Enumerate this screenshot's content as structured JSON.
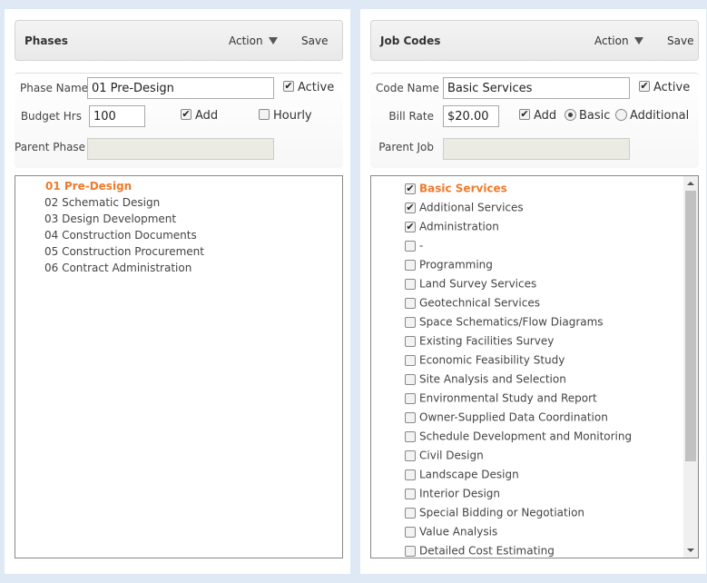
{
  "phases": {
    "header": {
      "title": "Phases",
      "action_label": "Action",
      "save_label": "Save"
    },
    "form": {
      "phase_name_label": "Phase Name",
      "phase_name_value": "01 Pre-Design",
      "active_label": "Active",
      "active_checked": true,
      "budget_hrs_label": "Budget Hrs",
      "budget_hrs_value": "100",
      "add_label": "Add",
      "add_checked": true,
      "hourly_label": "Hourly",
      "hourly_checked": false,
      "parent_phase_label": "Parent Phase",
      "parent_phase_value": ""
    },
    "items": [
      {
        "label": "01 Pre-Design",
        "selected": true
      },
      {
        "label": "02 Schematic Design",
        "selected": false
      },
      {
        "label": "03 Design Development",
        "selected": false
      },
      {
        "label": "04 Construction Documents",
        "selected": false
      },
      {
        "label": "05 Construction Procurement",
        "selected": false
      },
      {
        "label": "06 Contract Administration",
        "selected": false
      }
    ]
  },
  "job_codes": {
    "header": {
      "title": "Job Codes",
      "action_label": "Action",
      "save_label": "Save"
    },
    "form": {
      "code_name_label": "Code Name",
      "code_name_value": "Basic Services",
      "active_label": "Active",
      "active_checked": true,
      "bill_rate_label": "Bill Rate",
      "bill_rate_value": "$20.00",
      "add_label": "Add",
      "add_checked": true,
      "basic_label": "Basic",
      "additional_label": "Additional",
      "rate_type_selected": "Basic",
      "parent_job_label": "Parent Job",
      "parent_job_value": ""
    },
    "items": [
      {
        "label": "Basic Services",
        "checked": true,
        "selected": true
      },
      {
        "label": "Additional Services",
        "checked": true,
        "selected": false
      },
      {
        "label": "Administration",
        "checked": true,
        "selected": false
      },
      {
        "label": "-",
        "checked": false,
        "selected": false
      },
      {
        "label": "Programming",
        "checked": false,
        "selected": false
      },
      {
        "label": "Land Survey Services",
        "checked": false,
        "selected": false
      },
      {
        "label": "Geotechnical Services",
        "checked": false,
        "selected": false
      },
      {
        "label": "Space Schematics/Flow Diagrams",
        "checked": false,
        "selected": false
      },
      {
        "label": "Existing Facilities Survey",
        "checked": false,
        "selected": false
      },
      {
        "label": "Economic Feasibility Study",
        "checked": false,
        "selected": false
      },
      {
        "label": "Site Analysis and Selection",
        "checked": false,
        "selected": false
      },
      {
        "label": "Environmental Study and Report",
        "checked": false,
        "selected": false
      },
      {
        "label": "Owner-Supplied Data Coordination",
        "checked": false,
        "selected": false
      },
      {
        "label": "Schedule Development and Monitoring",
        "checked": false,
        "selected": false
      },
      {
        "label": "Civil Design",
        "checked": false,
        "selected": false
      },
      {
        "label": "Landscape Design",
        "checked": false,
        "selected": false
      },
      {
        "label": "Interior Design",
        "checked": false,
        "selected": false
      },
      {
        "label": "Special Bidding or Negotiation",
        "checked": false,
        "selected": false
      },
      {
        "label": "Value Analysis",
        "checked": false,
        "selected": false
      },
      {
        "label": "Detailed Cost Estimating",
        "checked": false,
        "selected": false
      }
    ]
  },
  "colors": {
    "accent": "#ee7b2c",
    "background": "#dfe8f5"
  }
}
